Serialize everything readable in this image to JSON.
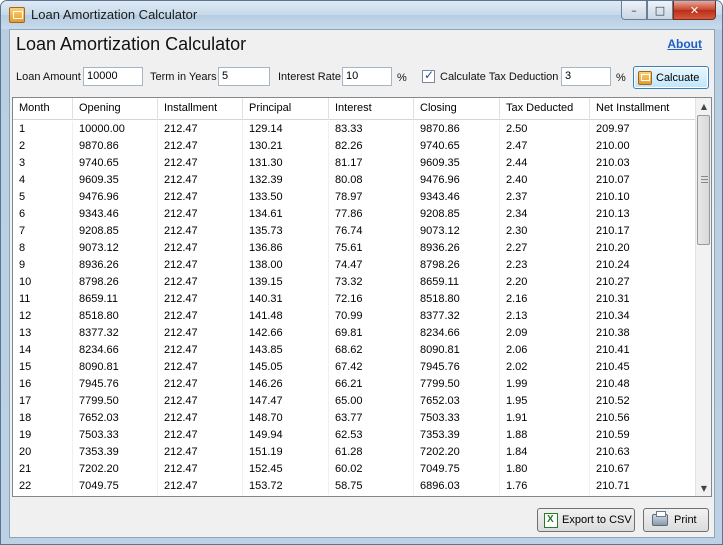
{
  "window": {
    "title": "Loan Amortization Calculator",
    "controls": {
      "minimize": "–",
      "maximize": "□",
      "close": "✕"
    }
  },
  "header": {
    "heading": "Loan Amortization Calculator",
    "about_link": "About"
  },
  "form": {
    "loan_amount_label": "Loan Amount",
    "loan_amount_value": "10000",
    "term_label": "Term in Years",
    "term_value": "5",
    "interest_label": "Interest Rate",
    "interest_value": "10",
    "interest_unit": "%",
    "tax_checkbox_label": "Calculate Tax Deduction",
    "tax_checked": true,
    "tax_value": "3",
    "tax_unit": "%",
    "calculate_label": "Calcuate"
  },
  "table": {
    "columns": [
      "Month",
      "Opening",
      "Installment",
      "Principal",
      "Interest",
      "Closing",
      "Tax Deducted",
      "Net Installment"
    ],
    "rows": [
      [
        "1",
        "10000.00",
        "212.47",
        "129.14",
        "83.33",
        "9870.86",
        "2.50",
        "209.97"
      ],
      [
        "2",
        "9870.86",
        "212.47",
        "130.21",
        "82.26",
        "9740.65",
        "2.47",
        "210.00"
      ],
      [
        "3",
        "9740.65",
        "212.47",
        "131.30",
        "81.17",
        "9609.35",
        "2.44",
        "210.03"
      ],
      [
        "4",
        "9609.35",
        "212.47",
        "132.39",
        "80.08",
        "9476.96",
        "2.40",
        "210.07"
      ],
      [
        "5",
        "9476.96",
        "212.47",
        "133.50",
        "78.97",
        "9343.46",
        "2.37",
        "210.10"
      ],
      [
        "6",
        "9343.46",
        "212.47",
        "134.61",
        "77.86",
        "9208.85",
        "2.34",
        "210.13"
      ],
      [
        "7",
        "9208.85",
        "212.47",
        "135.73",
        "76.74",
        "9073.12",
        "2.30",
        "210.17"
      ],
      [
        "8",
        "9073.12",
        "212.47",
        "136.86",
        "75.61",
        "8936.26",
        "2.27",
        "210.20"
      ],
      [
        "9",
        "8936.26",
        "212.47",
        "138.00",
        "74.47",
        "8798.26",
        "2.23",
        "210.24"
      ],
      [
        "10",
        "8798.26",
        "212.47",
        "139.15",
        "73.32",
        "8659.11",
        "2.20",
        "210.27"
      ],
      [
        "11",
        "8659.11",
        "212.47",
        "140.31",
        "72.16",
        "8518.80",
        "2.16",
        "210.31"
      ],
      [
        "12",
        "8518.80",
        "212.47",
        "141.48",
        "70.99",
        "8377.32",
        "2.13",
        "210.34"
      ],
      [
        "13",
        "8377.32",
        "212.47",
        "142.66",
        "69.81",
        "8234.66",
        "2.09",
        "210.38"
      ],
      [
        "14",
        "8234.66",
        "212.47",
        "143.85",
        "68.62",
        "8090.81",
        "2.06",
        "210.41"
      ],
      [
        "15",
        "8090.81",
        "212.47",
        "145.05",
        "67.42",
        "7945.76",
        "2.02",
        "210.45"
      ],
      [
        "16",
        "7945.76",
        "212.47",
        "146.26",
        "66.21",
        "7799.50",
        "1.99",
        "210.48"
      ],
      [
        "17",
        "7799.50",
        "212.47",
        "147.47",
        "65.00",
        "7652.03",
        "1.95",
        "210.52"
      ],
      [
        "18",
        "7652.03",
        "212.47",
        "148.70",
        "63.77",
        "7503.33",
        "1.91",
        "210.56"
      ],
      [
        "19",
        "7503.33",
        "212.47",
        "149.94",
        "62.53",
        "7353.39",
        "1.88",
        "210.59"
      ],
      [
        "20",
        "7353.39",
        "212.47",
        "151.19",
        "61.28",
        "7202.20",
        "1.84",
        "210.63"
      ],
      [
        "21",
        "7202.20",
        "212.47",
        "152.45",
        "60.02",
        "7049.75",
        "1.80",
        "210.67"
      ],
      [
        "22",
        "7049.75",
        "212.47",
        "153.72",
        "58.75",
        "6896.03",
        "1.76",
        "210.71"
      ]
    ]
  },
  "footer": {
    "export_label": "Export to CSV",
    "print_label": "Print"
  },
  "colors": {
    "link": "#1e5fc8",
    "calculate_button_border": "#3c7fb1",
    "close_button": "#c7432b"
  },
  "icons": {
    "app": "calculator-icon",
    "calculate": "calculator-icon",
    "export": "excel-icon",
    "print": "printer-icon"
  }
}
